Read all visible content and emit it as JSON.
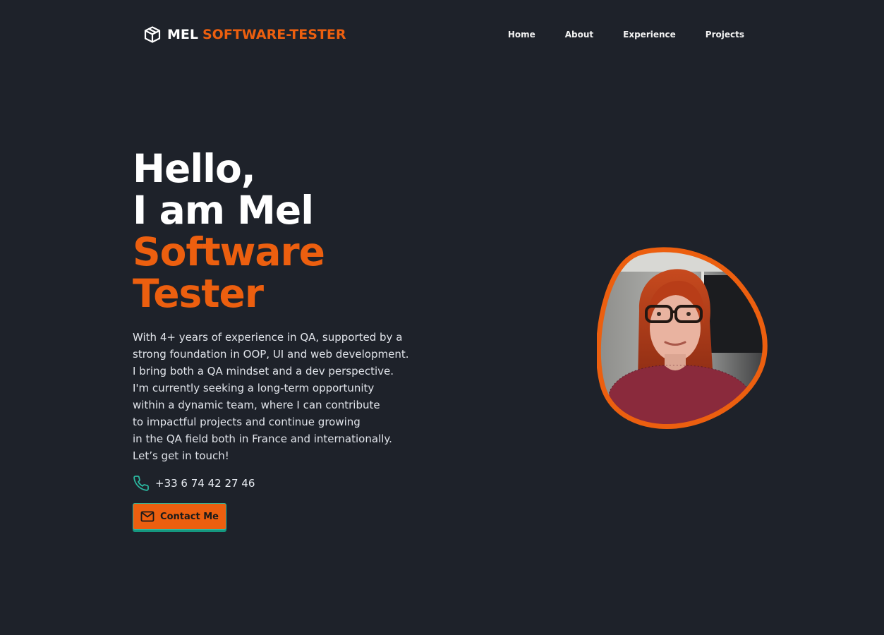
{
  "header": {
    "brand_name": "MEL",
    "brand_subtitle": "SOFTWARE-TESTER",
    "brand_icon": "cube-icon",
    "nav": [
      {
        "label": "Home"
      },
      {
        "label": "About"
      },
      {
        "label": "Experience"
      },
      {
        "label": "Projects"
      }
    ]
  },
  "hero": {
    "greeting": "Hello,",
    "intro": "I am Mel",
    "role_line1": "Software",
    "role_line2": "Tester",
    "description_lines": [
      "With 4+ years of experience in QA, supported by a",
      "strong foundation in OOP, UI and web development.",
      "I bring both a QA mindset and a dev perspective.",
      "I'm currently seeking a long-term opportunity",
      "within a dynamic team, where I can contribute",
      "to impactful projects and continue growing",
      "in the QA field both in France and internationally.",
      "Let’s get in touch!"
    ],
    "phone": "+33 6 74 42 27 46",
    "phone_icon": "phone-icon",
    "contact_button": "Contact Me",
    "contact_icon": "mail-icon",
    "portrait_alt": "profile-photo"
  },
  "colors": {
    "background": "#1e222a",
    "accent": "#ec5f0f",
    "teal": "#2bb8a0",
    "text": "#ffffff"
  }
}
